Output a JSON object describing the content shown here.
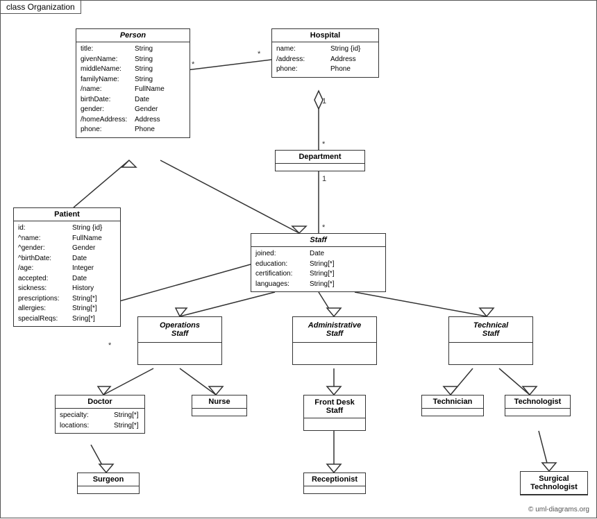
{
  "diagram": {
    "title": "class Organization",
    "copyright": "© uml-diagrams.org",
    "classes": {
      "person": {
        "name": "Person",
        "italic": true,
        "attrs": [
          {
            "name": "title:",
            "type": "String"
          },
          {
            "name": "givenName:",
            "type": "String"
          },
          {
            "name": "middleName:",
            "type": "String"
          },
          {
            "name": "familyName:",
            "type": "String"
          },
          {
            "name": "/name:",
            "type": "FullName"
          },
          {
            "name": "birthDate:",
            "type": "Date"
          },
          {
            "name": "gender:",
            "type": "Gender"
          },
          {
            "name": "/homeAddress:",
            "type": "Address"
          },
          {
            "name": "phone:",
            "type": "Phone"
          }
        ]
      },
      "hospital": {
        "name": "Hospital",
        "italic": false,
        "attrs": [
          {
            "name": "name:",
            "type": "String {id}"
          },
          {
            "name": "/address:",
            "type": "Address"
          },
          {
            "name": "phone:",
            "type": "Phone"
          }
        ]
      },
      "department": {
        "name": "Department",
        "italic": false,
        "attrs": []
      },
      "staff": {
        "name": "Staff",
        "italic": true,
        "attrs": [
          {
            "name": "joined:",
            "type": "Date"
          },
          {
            "name": "education:",
            "type": "String[*]"
          },
          {
            "name": "certification:",
            "type": "String[*]"
          },
          {
            "name": "languages:",
            "type": "String[*]"
          }
        ]
      },
      "patient": {
        "name": "Patient",
        "italic": false,
        "attrs": [
          {
            "name": "id:",
            "type": "String {id}"
          },
          {
            "name": "^name:",
            "type": "FullName"
          },
          {
            "name": "^gender:",
            "type": "Gender"
          },
          {
            "name": "^birthDate:",
            "type": "Date"
          },
          {
            "name": "/age:",
            "type": "Integer"
          },
          {
            "name": "accepted:",
            "type": "Date"
          },
          {
            "name": "sickness:",
            "type": "History"
          },
          {
            "name": "prescriptions:",
            "type": "String[*]"
          },
          {
            "name": "allergies:",
            "type": "String[*]"
          },
          {
            "name": "specialReqs:",
            "type": "Sring[*]"
          }
        ]
      },
      "operations_staff": {
        "name": "Operations Staff",
        "italic": true
      },
      "administrative_staff": {
        "name": "Administrative Staff",
        "italic": true
      },
      "technical_staff": {
        "name": "Technical Staff",
        "italic": true
      },
      "doctor": {
        "name": "Doctor",
        "italic": false,
        "attrs": [
          {
            "name": "specialty:",
            "type": "String[*]"
          },
          {
            "name": "locations:",
            "type": "String[*]"
          }
        ]
      },
      "nurse": {
        "name": "Nurse",
        "italic": false
      },
      "front_desk_staff": {
        "name": "Front Desk Staff",
        "italic": false
      },
      "technician": {
        "name": "Technician",
        "italic": false
      },
      "technologist": {
        "name": "Technologist",
        "italic": false
      },
      "surgeon": {
        "name": "Surgeon",
        "italic": false
      },
      "receptionist": {
        "name": "Receptionist",
        "italic": false
      },
      "surgical_technologist": {
        "name": "Surgical Technologist",
        "italic": false
      }
    }
  }
}
